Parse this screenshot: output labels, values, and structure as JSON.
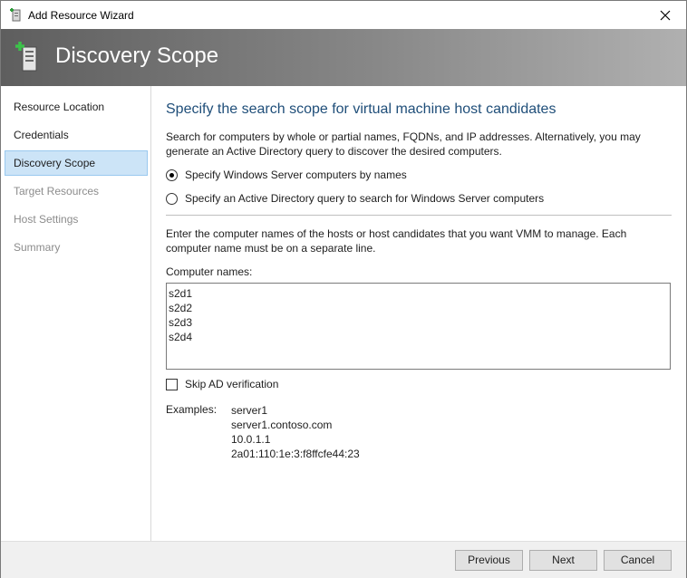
{
  "window": {
    "title": "Add Resource Wizard",
    "close_icon": "close-icon"
  },
  "banner": {
    "title": "Discovery Scope",
    "icon": "add-server-icon"
  },
  "sidebar": {
    "items": [
      {
        "label": "Resource Location",
        "state": "normal"
      },
      {
        "label": "Credentials",
        "state": "normal"
      },
      {
        "label": "Discovery Scope",
        "state": "active"
      },
      {
        "label": "Target Resources",
        "state": "disabled"
      },
      {
        "label": "Host Settings",
        "state": "disabled"
      },
      {
        "label": "Summary",
        "state": "disabled"
      }
    ]
  },
  "main": {
    "heading": "Specify the search scope for virtual machine host candidates",
    "description": "Search for computers by whole or partial names, FQDNs, and IP addresses. Alternatively, you may generate an Active Directory query to discover the desired computers.",
    "radio_options": [
      {
        "label": "Specify Windows Server computers by names",
        "checked": true
      },
      {
        "label": "Specify an Active Directory query to search for Windows Server computers",
        "checked": false
      }
    ],
    "instructions": "Enter the computer names of the hosts or host candidates that you want VMM to manage. Each computer name must be on a separate line.",
    "computer_names_label": "Computer names:",
    "computer_names": [
      "s2d1",
      "s2d2",
      "s2d3",
      "s2d4"
    ],
    "skip_ad_label": "Skip AD verification",
    "skip_ad_checked": false,
    "examples_label": "Examples:",
    "examples": [
      "server1",
      "server1.contoso.com",
      "10.0.1.1",
      "2a01:110:1e:3:f8ffcfe44:23"
    ]
  },
  "footer": {
    "previous_label": "Previous",
    "next_label": "Next",
    "cancel_label": "Cancel"
  },
  "colors": {
    "accent": "#1f4e79",
    "selected_bg": "#cce4f7",
    "disabled_text": "#8c8c8c"
  }
}
